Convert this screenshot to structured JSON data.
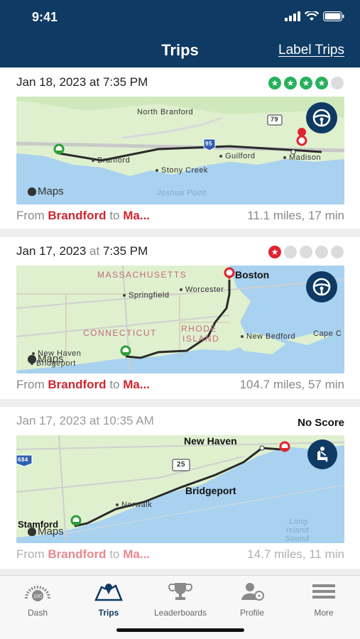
{
  "status": {
    "time": "9:41"
  },
  "header": {
    "title": "Trips",
    "label_trips": "Label Trips"
  },
  "common": {
    "from": "From",
    "to": "to",
    "maps_brand": "Maps"
  },
  "trips": [
    {
      "date": "Jan 18, 2023",
      "at": "at",
      "time": "7:35 PM",
      "rating": 4,
      "max_rating": 5,
      "score_color": "#26b15d",
      "mode": "driving",
      "mode_icon": "steering-wheel-icon",
      "origin": "Brandford",
      "destination": "Ma...",
      "stats": "11.1 miles, 17 min",
      "places": [
        "North Branford",
        "Branford",
        "Stony Creek",
        "Guilford",
        "Madison",
        "Joshua Point",
        "79",
        "95"
      ]
    },
    {
      "date": "Jan 17, 2023",
      "at": "at",
      "time": "7:35 PM",
      "rating": 1,
      "max_rating": 5,
      "score_color": "#e0232d",
      "mode": "driving",
      "mode_icon": "steering-wheel-icon",
      "origin": "Brandford",
      "destination": "Ma...",
      "stats": "104.7 miles, 57 min",
      "places": [
        "MASSACHUSETTS",
        "Boston",
        "Springfield",
        "Worcester",
        "CONNECTICUT",
        "RHODE",
        "ISLAND",
        "New Bedford",
        "Cape C",
        "New Haven",
        "Bridgeport"
      ]
    },
    {
      "date": "Jan 17, 2023",
      "at": "at",
      "time": "10:35 AM",
      "score_text": "No Score",
      "mode": "passenger",
      "mode_icon": "passenger-seat-icon",
      "origin": "Brandford",
      "destination": "Ma...",
      "stats": "14.7 miles, 11 min",
      "places": [
        "New Haven",
        "Bridgeport",
        "Norwalk",
        "Stamford",
        "Long",
        "Island",
        "Sound",
        "25",
        "684"
      ]
    }
  ],
  "tabs": [
    {
      "label": "Dash",
      "icon": "speedometer-icon",
      "active": false
    },
    {
      "label": "Trips",
      "icon": "map-icon",
      "active": true
    },
    {
      "label": "Leaderboards",
      "icon": "trophy-icon",
      "active": false
    },
    {
      "label": "Profile",
      "icon": "profile-icon",
      "active": false
    },
    {
      "label": "More",
      "icon": "menu-icon",
      "active": false
    }
  ],
  "colors": {
    "header_bg": "#0e3a63",
    "accent_red": "#cc2630",
    "map_water": "#a9d1f0",
    "map_land": "#dff0cf"
  }
}
